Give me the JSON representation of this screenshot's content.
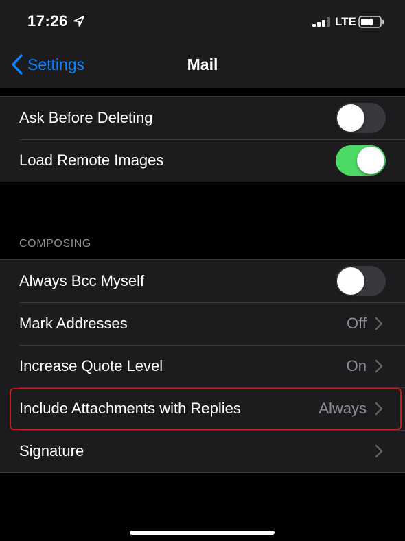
{
  "status_bar": {
    "time": "17:26",
    "carrier": "LTE",
    "location_icon": "location-arrow-icon",
    "signal_icon": "cellular-signal-icon",
    "battery_icon": "battery-icon"
  },
  "nav": {
    "back_label": "Settings",
    "title": "Mail"
  },
  "messages_group": [
    {
      "label": "Ask Before Deleting",
      "toggle": false
    },
    {
      "label": "Load Remote Images",
      "toggle": true
    }
  ],
  "composing": {
    "header": "COMPOSING",
    "rows": [
      {
        "label": "Always Bcc Myself",
        "toggle": false
      },
      {
        "label": "Mark Addresses",
        "value": "Off"
      },
      {
        "label": "Increase Quote Level",
        "value": "On"
      },
      {
        "label": "Include Attachments with Replies",
        "value": "Always",
        "highlighted": true
      },
      {
        "label": "Signature",
        "value": ""
      }
    ]
  },
  "colors": {
    "accent": "#0a84ff",
    "toggle_on": "#4cd964",
    "highlight": "#d0161b"
  }
}
